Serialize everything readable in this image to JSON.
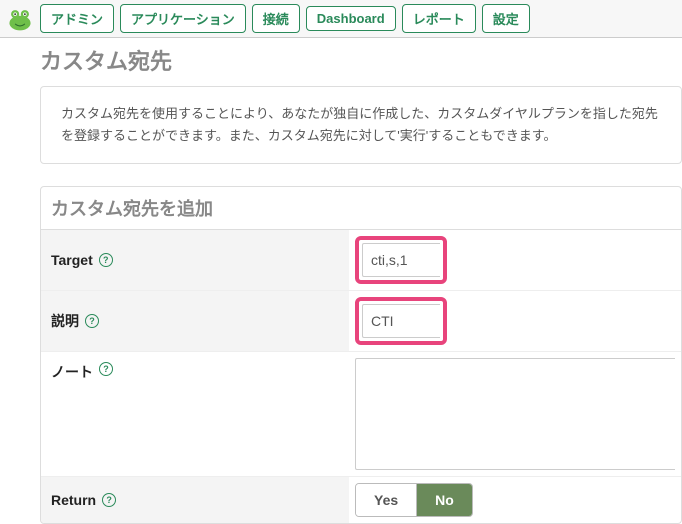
{
  "nav": {
    "items": [
      {
        "label": "アドミン"
      },
      {
        "label": "アプリケーション"
      },
      {
        "label": "接続"
      },
      {
        "label": "Dashboard"
      },
      {
        "label": "レポート"
      },
      {
        "label": "設定"
      }
    ]
  },
  "page": {
    "title": "カスタム宛先",
    "info": "カスタム宛先を使用することにより、あなたが独自に作成した、カスタムダイヤルプランを指した宛先を登録することができます。また、カスタム宛先に対して'実行'することもできます。"
  },
  "form": {
    "panel_title": "カスタム宛先を追加",
    "target": {
      "label": "Target",
      "value": "cti,s,1"
    },
    "description": {
      "label": "説明",
      "value": "CTI"
    },
    "notes": {
      "label": "ノート",
      "value": ""
    },
    "return": {
      "label": "Return",
      "options": {
        "yes": "Yes",
        "no": "No"
      },
      "value": "No"
    }
  }
}
